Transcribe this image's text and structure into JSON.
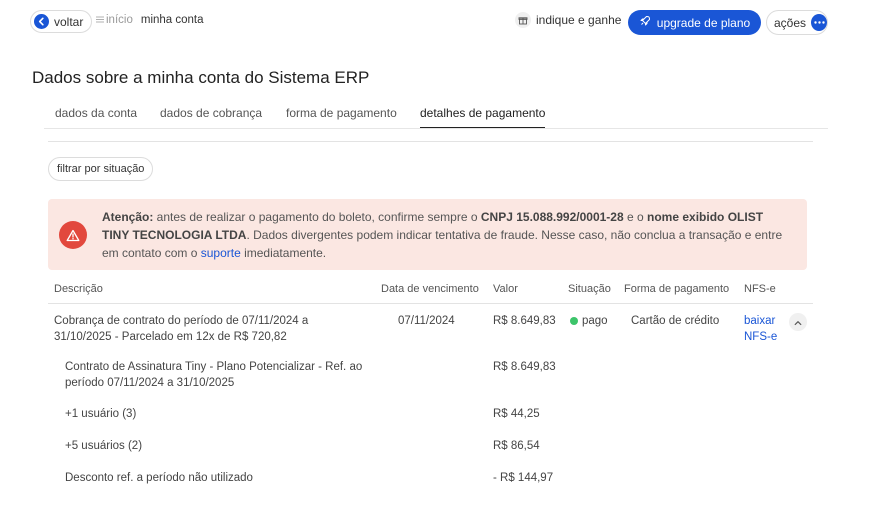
{
  "header": {
    "back_label": "voltar",
    "breadcrumb_home": "início",
    "breadcrumb_current": "minha conta",
    "refer_label": "indique e ganhe",
    "upgrade_label": "upgrade de plano",
    "actions_label": "ações"
  },
  "page": {
    "title": "Dados sobre a minha conta do Sistema ERP"
  },
  "tabs": [
    {
      "label": "dados da conta",
      "active": false
    },
    {
      "label": "dados de cobrança",
      "active": false
    },
    {
      "label": "forma de pagamento",
      "active": false
    },
    {
      "label": "detalhes de pagamento",
      "active": true
    }
  ],
  "filter": {
    "label": "filtrar por situação"
  },
  "alert": {
    "label_strong": "Atenção:",
    "text_1": " antes de realizar o pagamento do boleto, confirme sempre o ",
    "cnpj_strong": "CNPJ 15.088.992/0001-28",
    "text_2": " e o ",
    "name_strong": "nome exibido OLIST TINY TECNOLOGIA LTDA",
    "text_3": ". Dados divergentes podem indicar tentativa de fraude. Nesse caso, não conclua a transação e entre em contato com o ",
    "link_label": "suporte",
    "text_4": " imediatamente."
  },
  "table": {
    "headers": {
      "description": "Descrição",
      "due_date": "Data de vencimento",
      "value": "Valor",
      "status": "Situação",
      "payment_method": "Forma de pagamento",
      "nfse": "NFS-e"
    },
    "main_row": {
      "description": "Cobrança de contrato do período de 07/11/2024 a 31/10/2025 - Parcelado em 12x de R$ 720,82",
      "due_date": "07/11/2024",
      "value": "R$ 8.649,83",
      "status": "pago",
      "status_color": "#3cc46a",
      "payment_method": "Cartão de crédito",
      "nfse_link": "baixar NFS-e"
    },
    "sub_rows": [
      {
        "description": "Contrato de Assinatura Tiny - Plano Potencializar - Ref. ao período 07/11/2024 a 31/10/2025",
        "value": "R$ 8.649,83"
      },
      {
        "description": "+1 usuário (3)",
        "value": "R$ 44,25"
      },
      {
        "description": "+5 usuários (2)",
        "value": "R$ 86,54"
      },
      {
        "description": "Desconto ref. a período não utilizado",
        "value": "- R$ 144,97"
      }
    ]
  },
  "colors": {
    "accent": "#1a56d6",
    "alert_bg": "#fbe7e2",
    "alert_icon": "#e2483d"
  }
}
